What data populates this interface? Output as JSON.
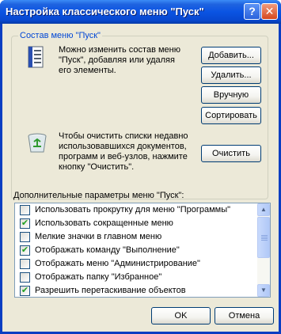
{
  "window": {
    "title": "Настройка классического меню \"Пуск\"",
    "help_glyph": "?",
    "close_glyph": "✕"
  },
  "group": {
    "title": "Состав меню \"Пуск\"",
    "desc1": [
      "Можно изменить состав меню",
      "\"Пуск\", добавляя или удаляя",
      "его элементы."
    ],
    "desc2": [
      "Чтобы очистить списки недавно",
      "использовавшихся документов,",
      "программ и веб-узлов, нажмите",
      "кнопку \"Очистить\"."
    ],
    "buttons": {
      "add": "Добавить...",
      "remove": "Удалить...",
      "manual": "Вручную",
      "sort": "Сортировать",
      "clear": "Очистить"
    }
  },
  "advanced": {
    "label": "Дополнительные параметры меню \"Пуск\":",
    "items": [
      {
        "label": "Использовать прокрутку для меню \"Программы\"",
        "checked": false
      },
      {
        "label": "Использовать сокращенные меню",
        "checked": true
      },
      {
        "label": "Мелкие значки в главном меню",
        "checked": false
      },
      {
        "label": "Отображать команду \"Выполнение\"",
        "checked": true
      },
      {
        "label": "Отображать меню \"Администрирование\"",
        "checked": false
      },
      {
        "label": "Отображать папку \"Избранное\"",
        "checked": false
      },
      {
        "label": "Разрешить перетаскивание объектов",
        "checked": true
      }
    ]
  },
  "footer": {
    "ok": "OK",
    "cancel": "Отмена"
  },
  "colors": {
    "title_bar": "#0a54e3",
    "dialog_bg": "#ece9d8",
    "group_title": "#0046d5",
    "check": "#21a121"
  }
}
